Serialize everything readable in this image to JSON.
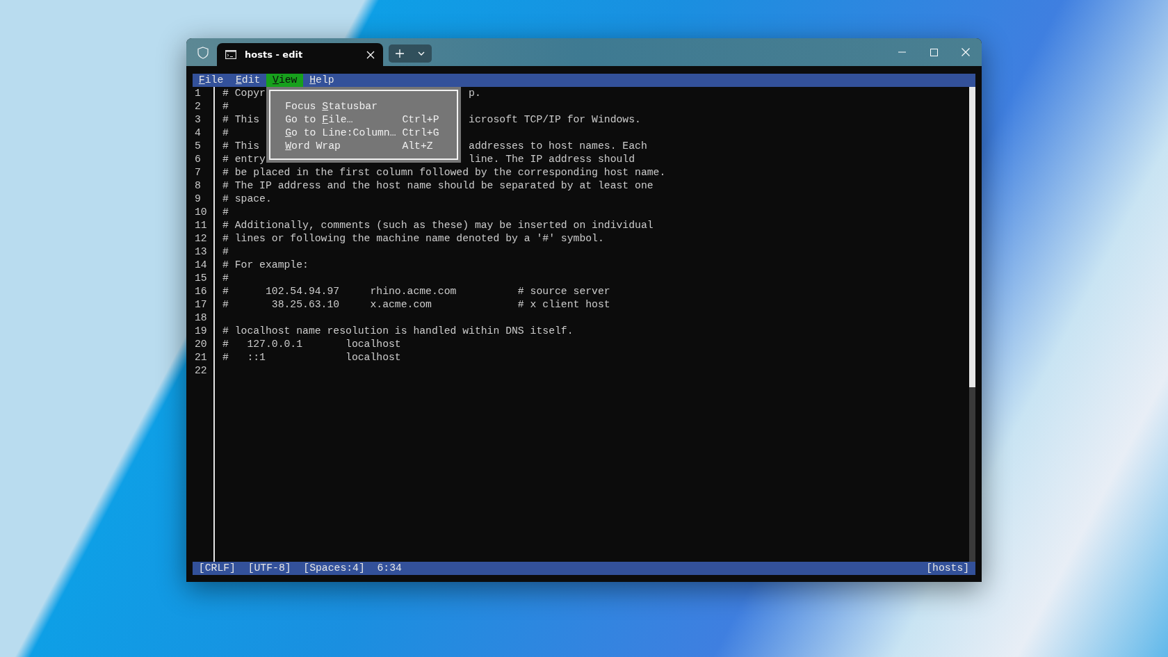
{
  "window": {
    "tab_title": "hosts - edit"
  },
  "menu_bar": [
    {
      "key": "F",
      "post": "ile",
      "selected": false
    },
    {
      "key": "E",
      "post": "dit",
      "selected": false
    },
    {
      "key": "V",
      "post": "iew",
      "selected": true
    },
    {
      "key": "H",
      "post": "elp",
      "selected": false
    }
  ],
  "dropdown": {
    "items": [
      {
        "pre": "Focus ",
        "key": "S",
        "post": "tatusbar"
      },
      {
        "pre": "Go to ",
        "key": "F",
        "post": "ile…",
        "shortcut": "Ctrl+P"
      },
      {
        "key": "G",
        "post": "o to Line:Column…",
        "shortcut": "Ctrl+G"
      },
      {
        "key": "W",
        "post": "ord Wrap",
        "shortcut": "Alt+Z"
      }
    ]
  },
  "lines": [
    {
      "number": "1",
      "text": "# Copyr",
      "text_after_menu": "p."
    },
    {
      "number": "2",
      "text": "#"
    },
    {
      "number": "3",
      "text": "# This",
      "text_after_menu": "icrosoft TCP/IP for Windows."
    },
    {
      "number": "4",
      "text": "#"
    },
    {
      "number": "5",
      "text": "# This",
      "text_after_menu": "addresses to host names. Each"
    },
    {
      "number": "6",
      "text": "# entry",
      "text_after_menu": "line. The IP address should"
    },
    {
      "number": "7",
      "text": "# be placed in the first column followed by the corresponding host name."
    },
    {
      "number": "8",
      "text": "# The IP address and the host name should be separated by at least one"
    },
    {
      "number": "9",
      "text": "# space."
    },
    {
      "number": "10",
      "text": "#"
    },
    {
      "number": "11",
      "text": "# Additionally, comments (such as these) may be inserted on individual"
    },
    {
      "number": "12",
      "text": "# lines or following the machine name denoted by a '#' symbol."
    },
    {
      "number": "13",
      "text": "#"
    },
    {
      "number": "14",
      "text": "# For example:"
    },
    {
      "number": "15",
      "text": "#"
    },
    {
      "number": "16",
      "text": "#      102.54.94.97     rhino.acme.com          # source server"
    },
    {
      "number": "17",
      "text": "#       38.25.63.10     x.acme.com              # x client host"
    },
    {
      "number": "18"
    },
    {
      "number": "19",
      "text": "# localhost name resolution is handled within DNS itself."
    },
    {
      "number": "20",
      "text": "#   127.0.0.1       localhost"
    },
    {
      "number": "21",
      "text": "#   ::1             localhost"
    },
    {
      "number": "22"
    }
  ],
  "status_bar": {
    "items": [
      "[CRLF]",
      "[UTF-8]",
      "[Spaces:4]",
      "6:34"
    ],
    "file": "[hosts]"
  }
}
